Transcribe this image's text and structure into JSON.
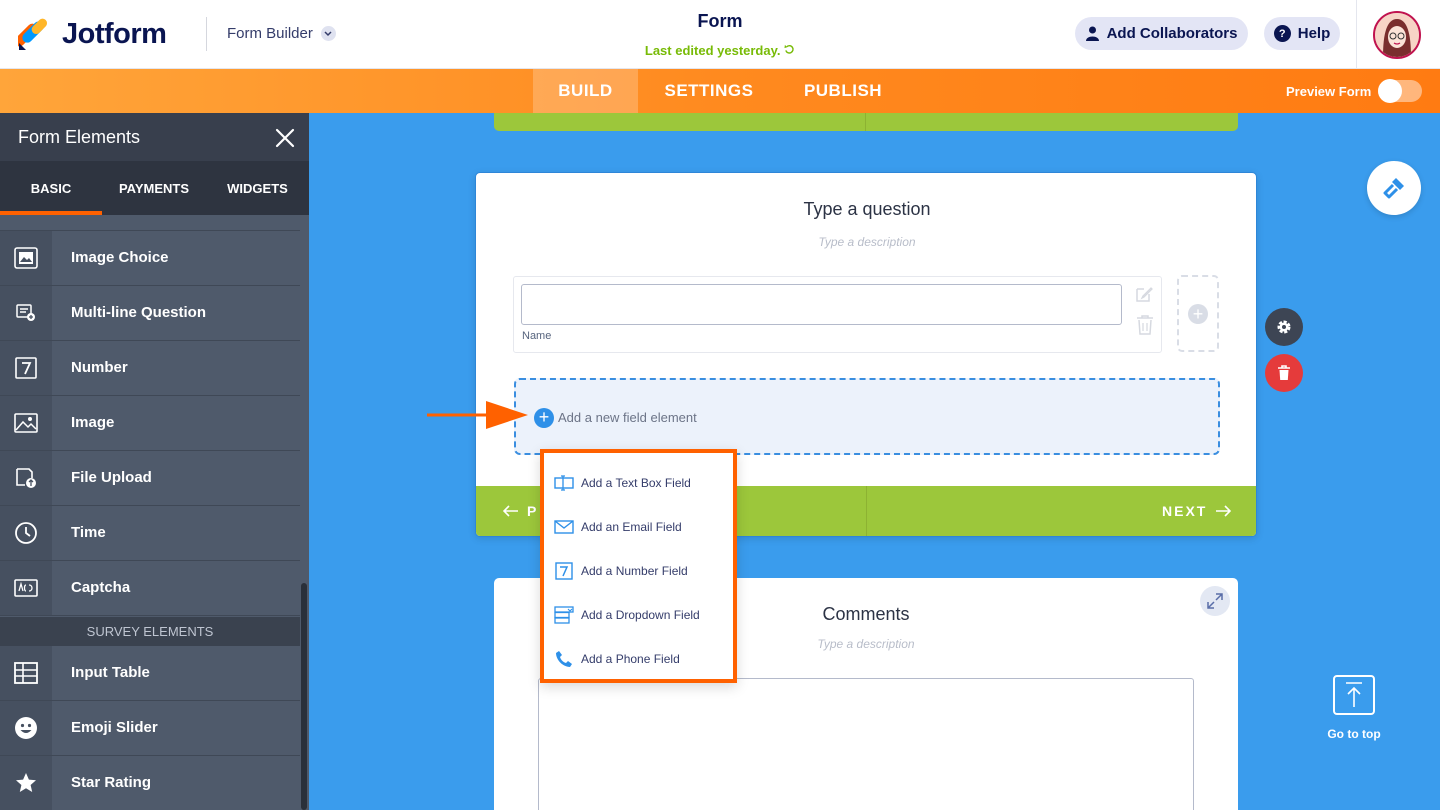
{
  "header": {
    "brand": "Jotform",
    "builder_label": "Form Builder",
    "form_title": "Form",
    "last_edited": "Last edited yesterday.",
    "collaborators_label": "Add Collaborators",
    "help_label": "Help"
  },
  "nav": {
    "tabs": [
      {
        "label": "BUILD",
        "active": true
      },
      {
        "label": "SETTINGS",
        "active": false
      },
      {
        "label": "PUBLISH",
        "active": false
      }
    ],
    "preview_label": "Preview Form",
    "preview_on": false
  },
  "panel": {
    "title": "Form Elements",
    "tabs": [
      {
        "label": "BASIC",
        "active": true
      },
      {
        "label": "PAYMENTS",
        "active": false
      },
      {
        "label": "WIDGETS",
        "active": false
      }
    ],
    "items": [
      {
        "label": "Image Choice",
        "icon": "image-choice-icon"
      },
      {
        "label": "Multi-line Question",
        "icon": "multi-line-icon"
      },
      {
        "label": "Number",
        "icon": "number-icon"
      },
      {
        "label": "Image",
        "icon": "image-icon"
      },
      {
        "label": "File Upload",
        "icon": "file-upload-icon"
      },
      {
        "label": "Time",
        "icon": "clock-icon"
      },
      {
        "label": "Captcha",
        "icon": "captcha-icon"
      }
    ],
    "survey_heading": "SURVEY ELEMENTS",
    "survey_items": [
      {
        "label": "Input Table",
        "icon": "table-icon"
      },
      {
        "label": "Emoji Slider",
        "icon": "emoji-icon"
      },
      {
        "label": "Star Rating",
        "icon": "star-icon"
      }
    ]
  },
  "question_card": {
    "title": "Type a question",
    "description_placeholder": "Type a description",
    "field_sublabel": "Name",
    "add_field_label": "Add a new field element",
    "prev_label": "P",
    "next_label": "NEXT"
  },
  "dropdown": {
    "items": [
      {
        "label": "Add a Text Box Field",
        "icon": "text-box-icon"
      },
      {
        "label": "Add an Email Field",
        "icon": "email-icon"
      },
      {
        "label": "Add a Number Field",
        "icon": "number-icon"
      },
      {
        "label": "Add a Dropdown Field",
        "icon": "dropdown-icon"
      },
      {
        "label": "Add a Phone Field",
        "icon": "phone-icon"
      }
    ]
  },
  "comments_card": {
    "title": "Comments",
    "description_placeholder": "Type a description"
  },
  "go_top_label": "Go to top",
  "colors": {
    "brand_orange": "#ff6100",
    "canvas_blue": "#3a9ced",
    "accent_green": "#9cc73b",
    "last_edited_green": "#78bb07",
    "navy": "#0a1551"
  }
}
